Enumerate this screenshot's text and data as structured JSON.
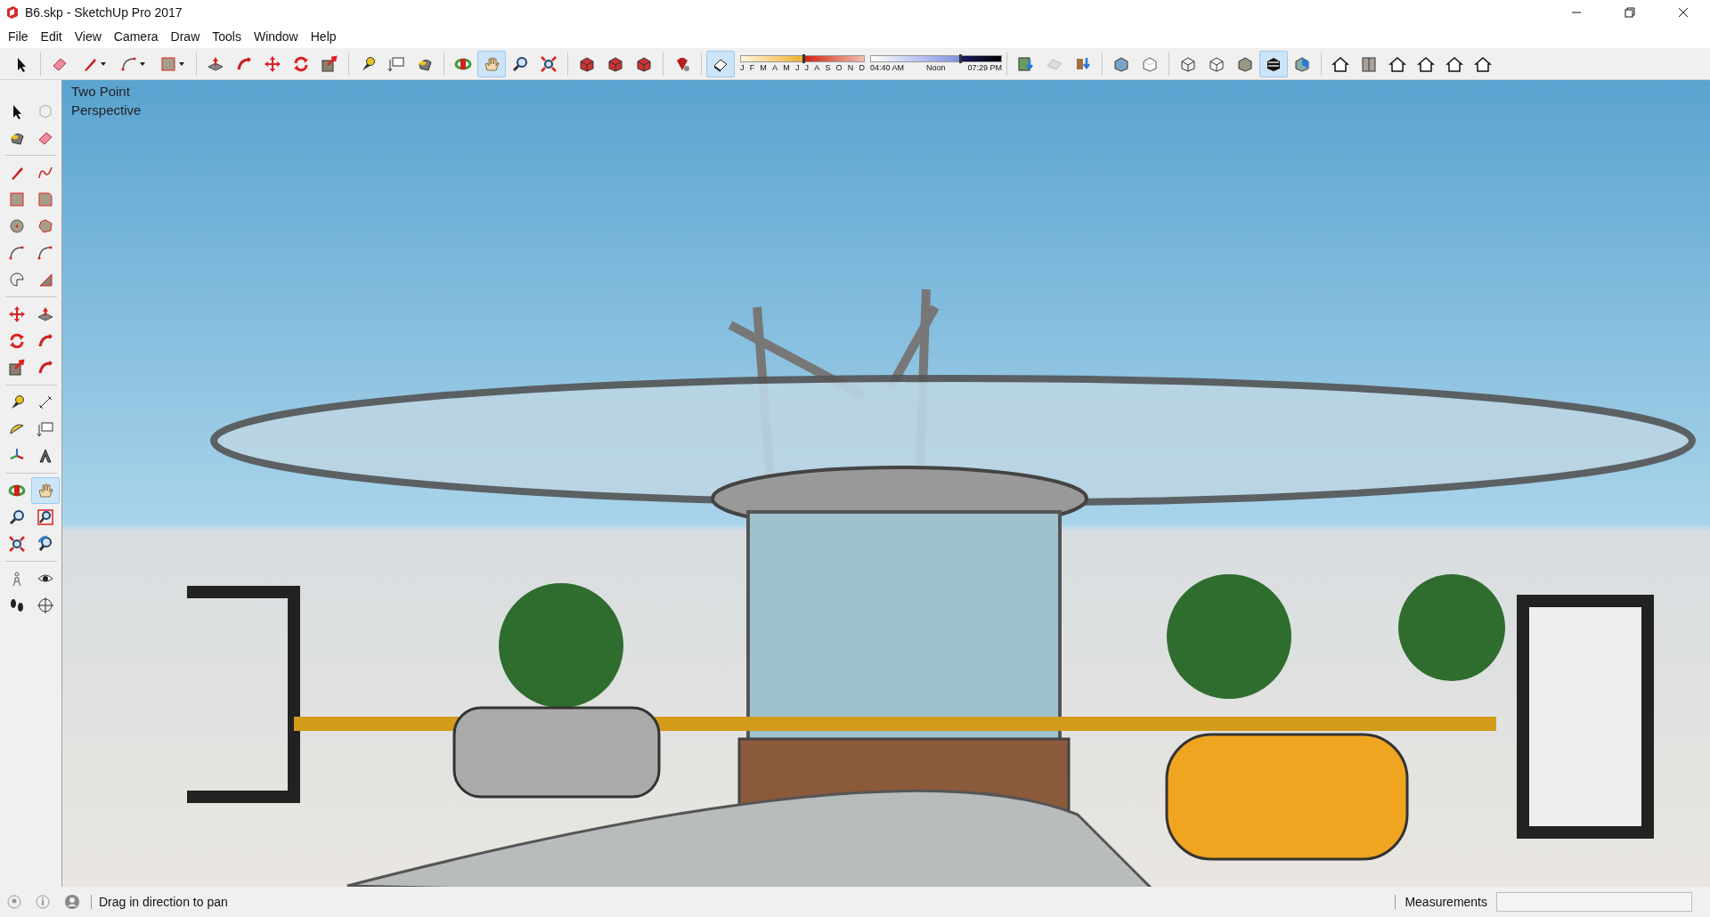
{
  "window": {
    "title": "B6.skp - SketchUp Pro 2017"
  },
  "menu": [
    "File",
    "Edit",
    "View",
    "Camera",
    "Draw",
    "Tools",
    "Window",
    "Help"
  ],
  "toolbar": {
    "groups": [
      [
        {
          "selected": false,
          "menu": false
        }
      ],
      [
        {
          "selected": false,
          "menu": false
        },
        {
          "selected": false,
          "menu": true
        },
        {
          "selected": false,
          "menu": true
        },
        {
          "selected": false,
          "menu": true
        }
      ],
      [
        {
          "selected": false,
          "menu": false
        },
        {
          "selected": false,
          "menu": false
        },
        {
          "selected": false,
          "menu": false
        },
        {
          "selected": false,
          "menu": false
        },
        {
          "selected": false,
          "menu": false
        }
      ],
      [
        {
          "selected": false,
          "menu": false
        },
        {
          "selected": false,
          "menu": false
        },
        {
          "selected": false,
          "menu": false
        }
      ],
      [
        {
          "selected": false,
          "menu": false
        },
        {
          "selected": true,
          "menu": false
        },
        {
          "selected": false,
          "menu": false
        },
        {
          "selected": false,
          "menu": false
        }
      ],
      [
        {
          "selected": false,
          "menu": false
        },
        {
          "selected": false,
          "menu": false
        },
        {
          "selected": false,
          "menu": false
        }
      ],
      [
        {
          "selected": false,
          "menu": false
        }
      ],
      [
        {
          "selected": true,
          "menu": false
        }
      ]
    ],
    "shadow": {
      "date_slider": {
        "labels": [
          "J",
          "F",
          "M",
          "A",
          "M",
          "J",
          "J",
          "A",
          "S",
          "O",
          "N",
          "D"
        ],
        "level": 0.5
      },
      "time_slider": {
        "labels": [
          "04:40 AM",
          "Noon",
          "07:29 PM"
        ],
        "level": 0.68
      }
    },
    "groups_after": [
      [
        {
          "selected": false
        },
        {
          "selected": false
        },
        {
          "selected": false
        }
      ],
      [
        {
          "selected": false
        },
        {
          "selected": false
        }
      ],
      [
        {
          "selected": false
        },
        {
          "selected": false
        },
        {
          "selected": false
        },
        {
          "selected": true
        },
        {
          "selected": false
        }
      ],
      [
        {
          "selected": false
        },
        {
          "selected": false
        },
        {
          "selected": false
        },
        {
          "selected": false
        },
        {
          "selected": false
        },
        {
          "selected": false
        }
      ]
    ]
  },
  "side_toolbar": [
    [
      {
        "selected": false
      },
      {
        "selected": false
      },
      {
        "selected": false
      },
      {
        "selected": false
      }
    ],
    [
      {
        "selected": false
      },
      {
        "selected": false
      },
      {
        "selected": false
      },
      {
        "selected": false
      },
      {
        "selected": false
      },
      {
        "selected": false
      },
      {
        "selected": false
      },
      {
        "selected": false
      },
      {
        "selected": false
      },
      {
        "selected": false
      }
    ],
    [
      {
        "selected": false
      },
      {
        "selected": false
      },
      {
        "selected": false
      },
      {
        "selected": false
      },
      {
        "selected": false
      },
      {
        "selected": false
      }
    ],
    [
      {
        "selected": false
      },
      {
        "selected": false
      },
      {
        "selected": false
      },
      {
        "selected": false
      },
      {
        "selected": false
      },
      {
        "selected": false
      }
    ],
    [
      {
        "selected": false
      },
      {
        "selected": true
      },
      {
        "selected": false
      },
      {
        "selected": false
      },
      {
        "selected": false
      },
      {
        "selected": false
      }
    ],
    [
      {
        "selected": false
      },
      {
        "selected": false
      },
      {
        "selected": false
      },
      {
        "selected": false
      }
    ]
  ],
  "viewport": {
    "camera_label": "Two Point Perspective"
  },
  "status_bar": {
    "hint": "Drag in direction to pan",
    "measurements_label": "Measurements"
  }
}
